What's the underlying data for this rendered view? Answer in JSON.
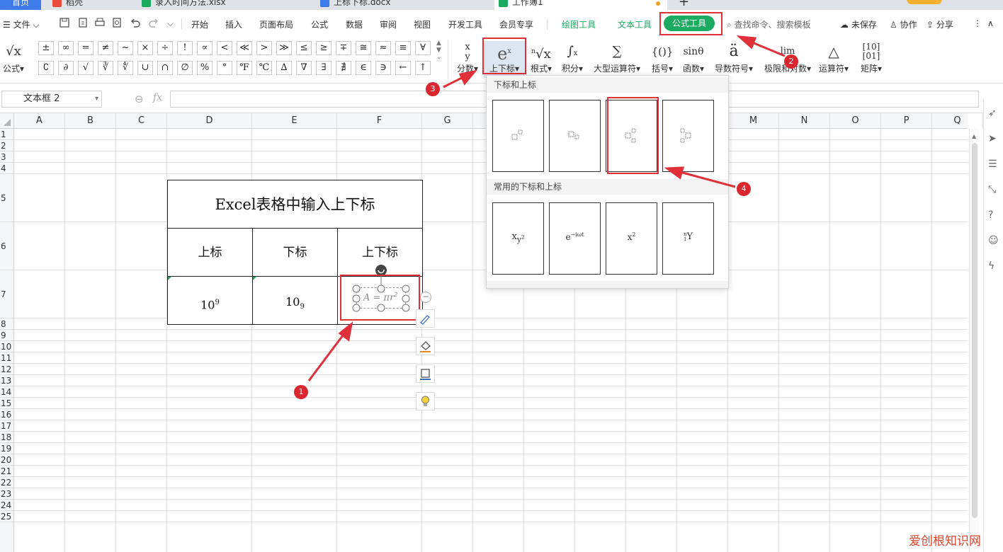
{
  "tabs": [
    {
      "label": "首页"
    },
    {
      "label": "稻壳"
    },
    {
      "label": "录入时间方法.xlsx"
    },
    {
      "label": "上标下标.docx"
    },
    {
      "label": "工作簿1"
    }
  ],
  "menu": {
    "file": "文件",
    "items": [
      "开始",
      "插入",
      "页面布局",
      "公式",
      "数据",
      "审阅",
      "视图",
      "开发工具",
      "会员专享"
    ],
    "tool_tabs": [
      "绘图工具",
      "文本工具",
      "公式工具"
    ],
    "search_placeholder": "查找命令、搜索模板",
    "unsaved": "未保存",
    "collab": "协作",
    "share": "分享"
  },
  "ribbon": {
    "formula_label": "公式",
    "symbols_row1": [
      "±",
      "∞",
      "=",
      "≠",
      "~",
      "×",
      "÷",
      "!",
      "∝",
      "<",
      "≪",
      ">",
      "≫",
      "≤",
      "≥",
      "∓",
      "≅",
      "≈",
      "≡",
      "∀"
    ],
    "symbols_row2": [
      "∁",
      "∂",
      "√",
      "∛",
      "∜",
      "∪",
      "∩",
      "∅",
      "%",
      "°",
      "℉",
      "℃",
      "∆",
      "∇",
      "∃",
      "∄",
      "∈",
      "∋",
      "←",
      "↑"
    ],
    "buttons": [
      {
        "glyph": "x/y",
        "label": "分数"
      },
      {
        "glyph": "eˣ",
        "label": "上下标"
      },
      {
        "glyph": "ⁿ√x",
        "label": "根式"
      },
      {
        "glyph": "∫",
        "label": "积分"
      },
      {
        "glyph": "∑",
        "label": "大型运算符"
      },
      {
        "glyph": "{()}",
        "label": "括号"
      },
      {
        "glyph": "sinθ",
        "label": "函数"
      },
      {
        "glyph": "ä",
        "label": "导数符号"
      },
      {
        "glyph": "lim",
        "label": "极限和对数"
      },
      {
        "glyph": "△",
        "label": "运算符"
      },
      {
        "glyph": "[10 01]",
        "label": "矩阵"
      }
    ]
  },
  "formula_bar": {
    "name_box": "文本框 2",
    "fx": "fx"
  },
  "columns": [
    "A",
    "B",
    "C",
    "D",
    "E",
    "F",
    "G",
    "H",
    "I",
    "J",
    "K",
    "L",
    "M",
    "N",
    "O",
    "P",
    "Q"
  ],
  "rows": [
    "1",
    "2",
    "3",
    "4",
    "5",
    "6",
    "7",
    "8",
    "9",
    "10",
    "11",
    "12",
    "13",
    "14",
    "15",
    "16",
    "17",
    "18",
    "19",
    "20",
    "21",
    "22",
    "23",
    "24",
    "25"
  ],
  "table": {
    "title": "Excel表格中输入上下标",
    "headers": [
      "上标",
      "下标",
      "上下标"
    ],
    "sup_base": "10",
    "sup_exp": "9",
    "sub_base": "10",
    "sub_idx": "9",
    "equation": "A = πr",
    "equation_exp": "2"
  },
  "dropdown": {
    "section1": "下标和上标",
    "section2": "常用的下标和上标",
    "common": [
      {
        "base": "x",
        "sub": "y",
        "sup": "2"
      },
      {
        "base": "e",
        "sup": "−iωt"
      },
      {
        "base": "x",
        "sup": "2"
      },
      {
        "base": "Y",
        "pre_sup": "n",
        "pre_sub": "1"
      }
    ]
  },
  "annotations": [
    "1",
    "2",
    "3",
    "4"
  ],
  "watermark": "爱创根知识网",
  "colors": {
    "accent_green": "#1aaa60",
    "annotation_red": "#e0303a"
  }
}
